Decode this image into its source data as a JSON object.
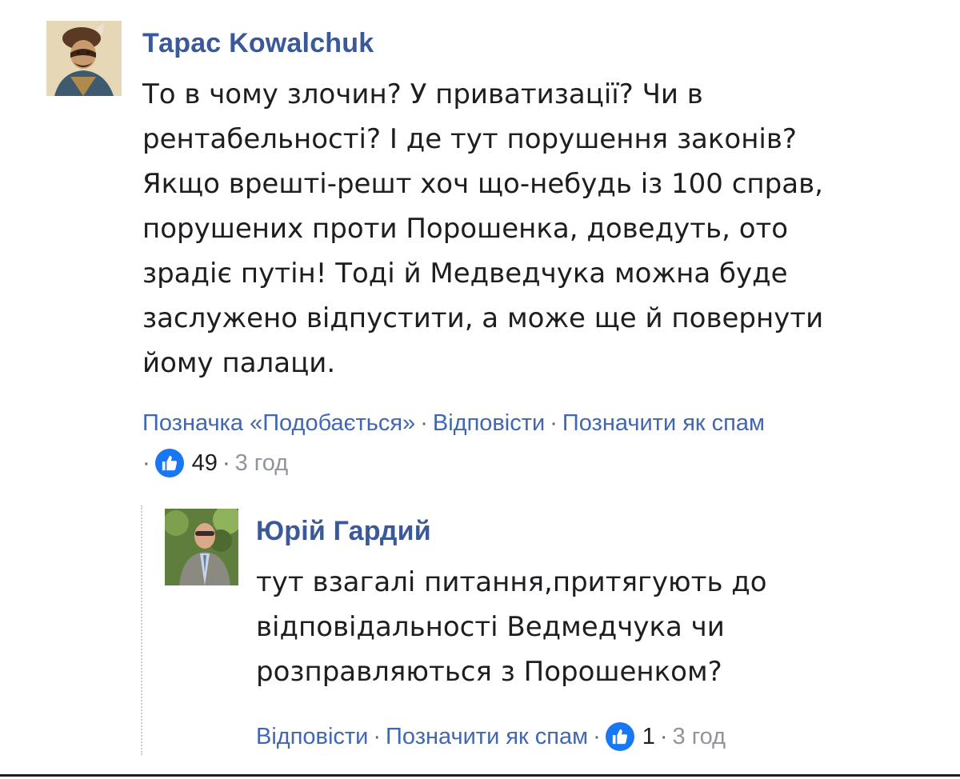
{
  "comment": {
    "author": "Тарас Kowalchuk",
    "text_lines": [
      "То в чому злочин? У приватизації? Чи в",
      "рентабельності? І де тут порушення законів?",
      "Якщо врешті-решт хоч що-небудь із 100 справ,",
      "порушених проти Порошенка, доведуть, ото",
      "зрадіє путін! Тоді й Медведчука можна буде",
      "заслужено відпустити, а може ще й повернути",
      "йому палаци."
    ],
    "actions": {
      "like": "Позначка «Подобається»",
      "reply": "Відповісти",
      "spam": "Позначити як спам"
    },
    "separator": "·",
    "like_count": "49",
    "time": "3 год"
  },
  "reply": {
    "author": "Юрій Гардий",
    "text_lines": [
      "тут взагалі питання,притягують до",
      "відповідальності Ведмедчука чи",
      "розправляються з Порошенком?"
    ],
    "actions": {
      "reply": "Відповісти",
      "spam": "Позначити як спам"
    },
    "separator": "·",
    "like_count": "1",
    "time": "3 год"
  },
  "colors": {
    "link": "#4267b2",
    "author": "#3b5998",
    "text": "#1c1e21",
    "muted": "#90949c",
    "like_badge": "#1877f2"
  },
  "icons": {
    "like": "thumbs-up-icon"
  }
}
